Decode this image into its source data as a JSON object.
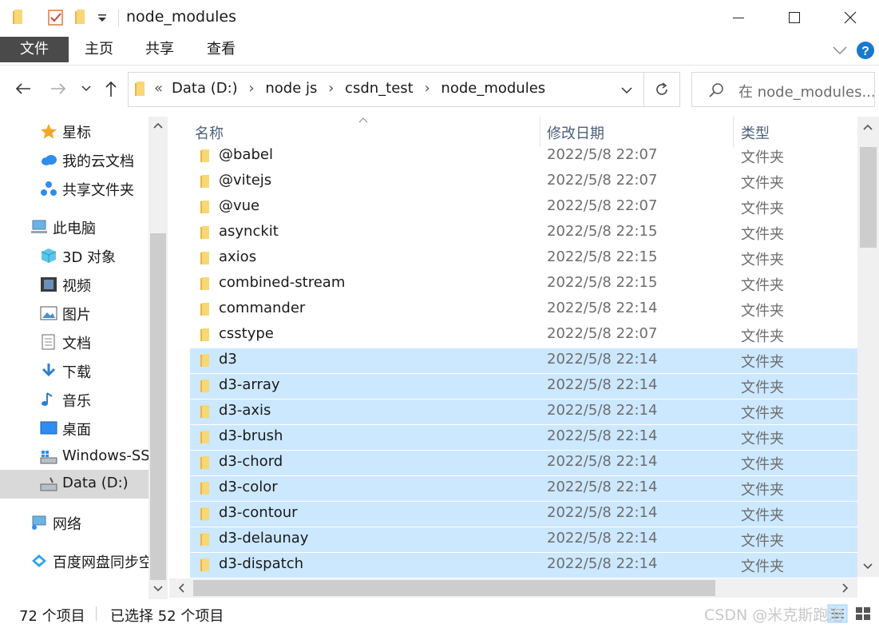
{
  "window": {
    "title": "node_modules",
    "controls": [
      "minimize",
      "maximize",
      "close"
    ]
  },
  "ribbon": {
    "tabs": [
      "文件",
      "主页",
      "共享",
      "查看"
    ]
  },
  "address": {
    "overflow": "«",
    "path": [
      "Data (D:)",
      "node js",
      "csdn_test",
      "node_modules"
    ],
    "search_placeholder": "在 node_modules..."
  },
  "nav": {
    "items": [
      {
        "label": "星标",
        "icon": "star-icon"
      },
      {
        "label": "我的云文档",
        "icon": "cloud-icon"
      },
      {
        "label": "共享文件夹",
        "icon": "shared-folder-icon"
      },
      {
        "label": "此电脑",
        "icon": "computer-icon"
      },
      {
        "label": "3D 对象",
        "icon": "cube-icon"
      },
      {
        "label": "视频",
        "icon": "video-icon"
      },
      {
        "label": "图片",
        "icon": "picture-icon"
      },
      {
        "label": "文档",
        "icon": "document-icon"
      },
      {
        "label": "下载",
        "icon": "download-icon"
      },
      {
        "label": "音乐",
        "icon": "music-icon"
      },
      {
        "label": "桌面",
        "icon": "desktop-icon"
      },
      {
        "label": "Windows-SSD",
        "icon": "drive-icon"
      },
      {
        "label": "Data (D:)",
        "icon": "drive-icon",
        "selected": true
      },
      {
        "label": "网络",
        "icon": "network-icon"
      },
      {
        "label": "百度网盘同步空间",
        "icon": "baidu-sync-icon"
      }
    ]
  },
  "columns": [
    "名称",
    "修改日期",
    "类型"
  ],
  "files": [
    {
      "name": "@babel",
      "date": "2022/5/8 22:07",
      "type": "文件夹",
      "selected": false
    },
    {
      "name": "@vitejs",
      "date": "2022/5/8 22:07",
      "type": "文件夹",
      "selected": false
    },
    {
      "name": "@vue",
      "date": "2022/5/8 22:07",
      "type": "文件夹",
      "selected": false
    },
    {
      "name": "asynckit",
      "date": "2022/5/8 22:15",
      "type": "文件夹",
      "selected": false
    },
    {
      "name": "axios",
      "date": "2022/5/8 22:15",
      "type": "文件夹",
      "selected": false
    },
    {
      "name": "combined-stream",
      "date": "2022/5/8 22:15",
      "type": "文件夹",
      "selected": false
    },
    {
      "name": "commander",
      "date": "2022/5/8 22:14",
      "type": "文件夹",
      "selected": false
    },
    {
      "name": "csstype",
      "date": "2022/5/8 22:07",
      "type": "文件夹",
      "selected": false
    },
    {
      "name": "d3",
      "date": "2022/5/8 22:14",
      "type": "文件夹",
      "selected": true
    },
    {
      "name": "d3-array",
      "date": "2022/5/8 22:14",
      "type": "文件夹",
      "selected": true
    },
    {
      "name": "d3-axis",
      "date": "2022/5/8 22:14",
      "type": "文件夹",
      "selected": true
    },
    {
      "name": "d3-brush",
      "date": "2022/5/8 22:14",
      "type": "文件夹",
      "selected": true
    },
    {
      "name": "d3-chord",
      "date": "2022/5/8 22:14",
      "type": "文件夹",
      "selected": true
    },
    {
      "name": "d3-color",
      "date": "2022/5/8 22:14",
      "type": "文件夹",
      "selected": true
    },
    {
      "name": "d3-contour",
      "date": "2022/5/8 22:14",
      "type": "文件夹",
      "selected": true
    },
    {
      "name": "d3-delaunay",
      "date": "2022/5/8 22:14",
      "type": "文件夹",
      "selected": true
    },
    {
      "name": "d3-dispatch",
      "date": "2022/5/8 22:14",
      "type": "文件夹",
      "selected": true
    }
  ],
  "status": {
    "count": "72 个项目",
    "selected": "已选择 52 个项目"
  },
  "watermark": "CSDN @米克斯跑泡",
  "colors": {
    "selection": "#cce8ff",
    "folder": "#f8d775",
    "file_tab": "#4a4a4a",
    "help": "#1979ca"
  }
}
